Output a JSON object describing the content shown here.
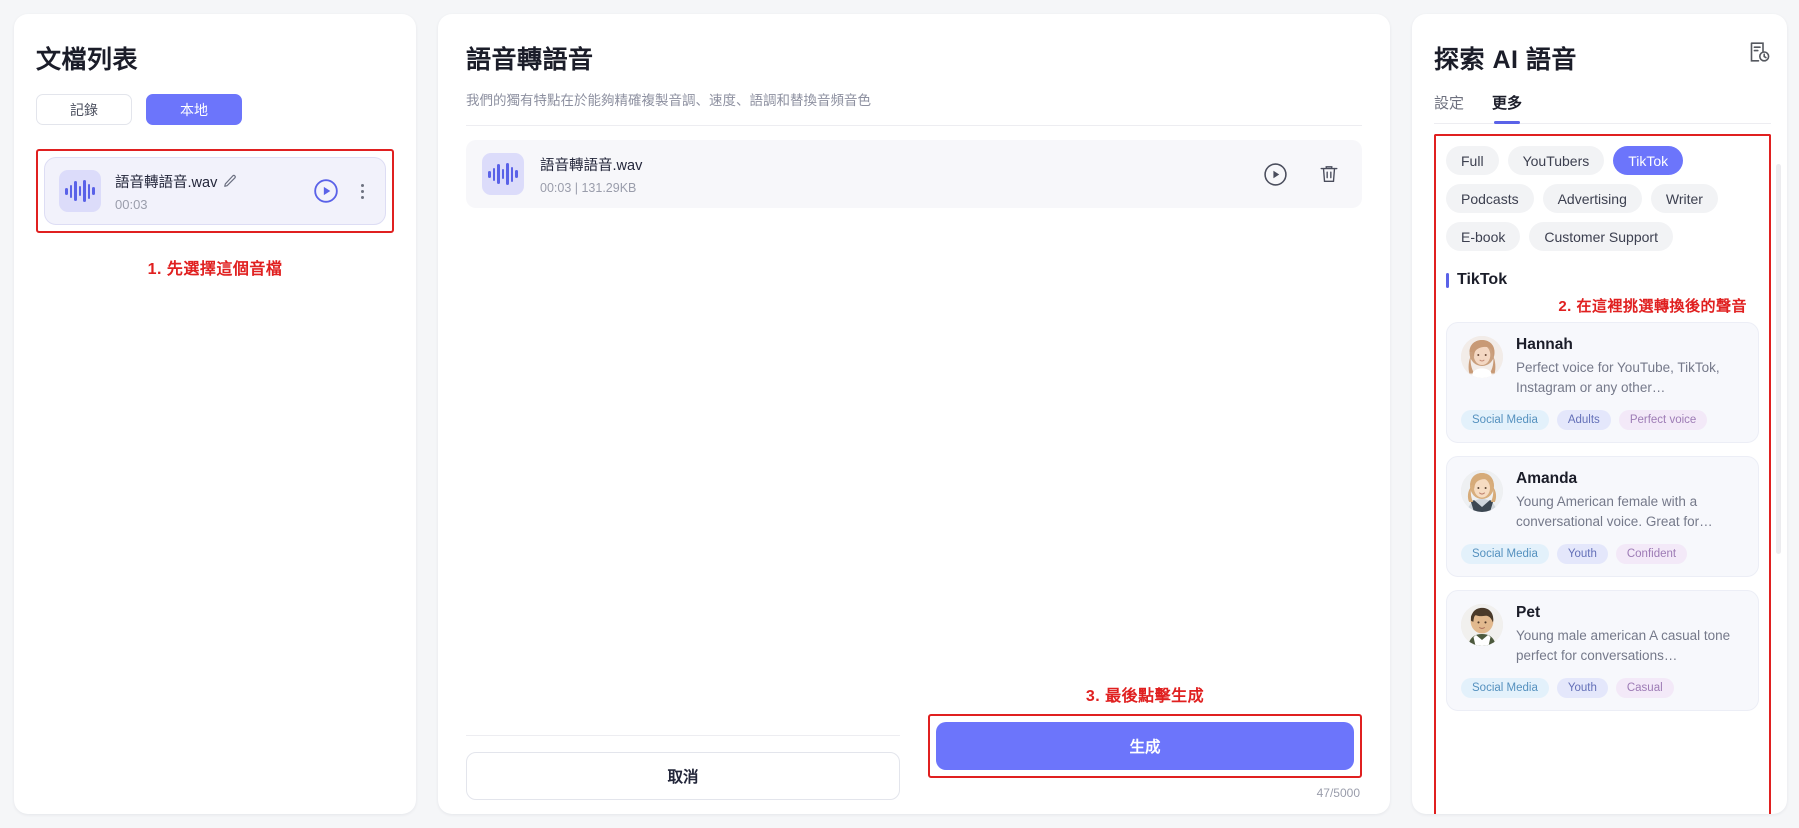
{
  "left": {
    "title": "文檔列表",
    "segments": [
      {
        "label": "記錄",
        "active": false
      },
      {
        "label": "本地",
        "active": true
      }
    ],
    "audio_item": {
      "name": "語音轉語音.wav",
      "duration": "00:03",
      "edit_icon": "pencil-icon",
      "play_icon": "play-circle-icon",
      "menu_icon": "kebab-menu-icon",
      "thumb_icon": "waveform-icon"
    },
    "annotation": "1. 先選擇這個音檔"
  },
  "middle": {
    "title": "語音轉語音",
    "subtitle": "我們的獨有特點在於能夠精確複製音調、速度、語調和替換音頻音色",
    "file": {
      "name": "語音轉語音.wav",
      "meta": "00:03 | 131.29KB",
      "thumb_icon": "waveform-icon",
      "play_icon": "play-circle-icon",
      "delete_icon": "trash-icon"
    },
    "annotation": "3. 最後點擊生成",
    "cancel_label": "取消",
    "generate_label": "生成",
    "counter": "47/5000"
  },
  "right": {
    "title": "探索 AI 語音",
    "history_icon": "history-document-icon",
    "tabs": [
      {
        "label": "設定",
        "active": false
      },
      {
        "label": "更多",
        "active": true
      }
    ],
    "chips": [
      {
        "label": "Full",
        "active": false
      },
      {
        "label": "YouTubers",
        "active": false
      },
      {
        "label": "TikTok",
        "active": true
      },
      {
        "label": "Podcasts",
        "active": false
      },
      {
        "label": "Advertising",
        "active": false
      },
      {
        "label": "Writer",
        "active": false
      },
      {
        "label": "E-book",
        "active": false
      },
      {
        "label": "Customer Support",
        "active": false
      }
    ],
    "section_title": "TikTok",
    "annotation": "2. 在這裡挑選轉換後的聲音",
    "voices": [
      {
        "name": "Hannah",
        "description": "Perfect voice for YouTube, TikTok, Instagram or any other…",
        "avatar_icon": "avatar-hannah",
        "tags": [
          {
            "label": "Social Media",
            "color": "blue"
          },
          {
            "label": "Adults",
            "color": "indigo"
          },
          {
            "label": "Perfect voice",
            "color": "pink"
          }
        ]
      },
      {
        "name": "Amanda",
        "description": "Young American female with a conversational voice. Great for…",
        "avatar_icon": "avatar-amanda",
        "tags": [
          {
            "label": "Social Media",
            "color": "blue"
          },
          {
            "label": "Youth",
            "color": "indigo"
          },
          {
            "label": "Confident",
            "color": "pink"
          }
        ]
      },
      {
        "name": "Pet",
        "description": "Young male american A casual tone perfect for conversations…",
        "avatar_icon": "avatar-pet",
        "tags": [
          {
            "label": "Social Media",
            "color": "blue"
          },
          {
            "label": "Youth",
            "color": "indigo"
          },
          {
            "label": "Casual",
            "color": "pink"
          }
        ]
      }
    ]
  },
  "colors": {
    "accent": "#6c75fb",
    "annotation": "#e02020",
    "page_bg": "#f5f6f8",
    "panel_bg": "#ffffff"
  }
}
